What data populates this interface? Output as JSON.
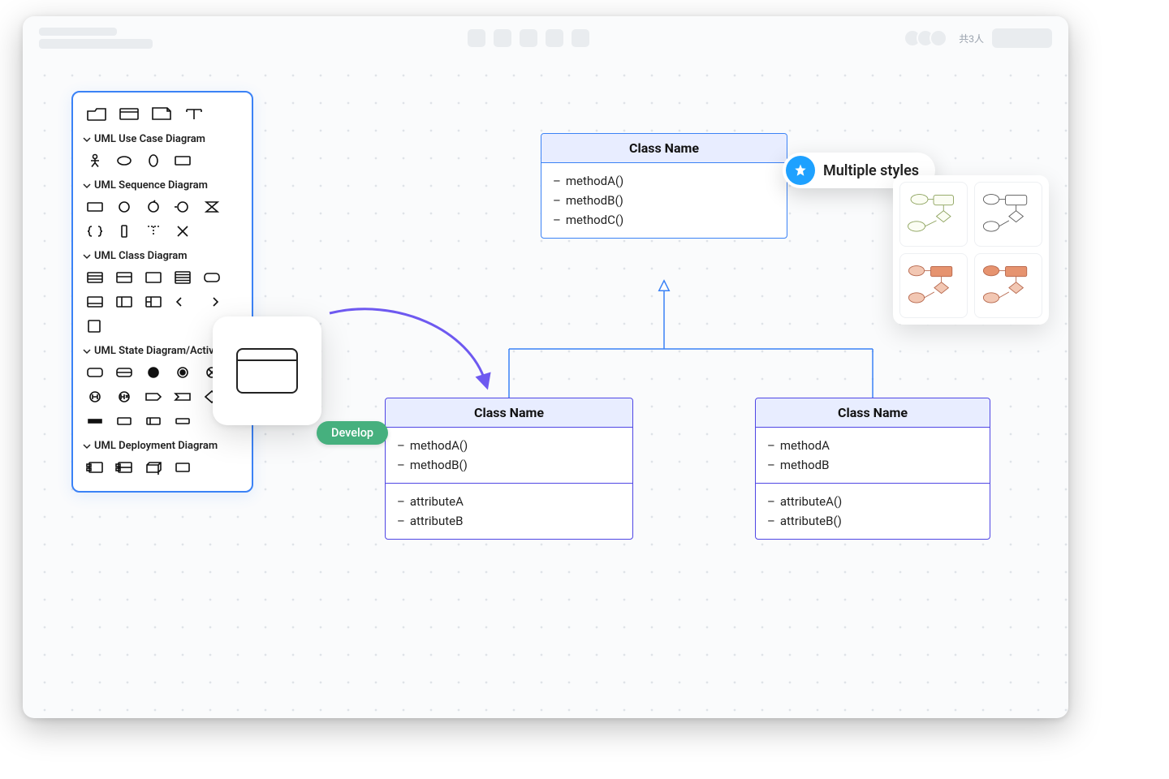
{
  "topbar": {
    "people_count_label": "共3人"
  },
  "sidebar": {
    "sections": [
      {
        "label": "UML Use Case Diagram"
      },
      {
        "label": "UML Sequence Diagram"
      },
      {
        "label": "UML Class Diagram"
      },
      {
        "label": "UML State Diagram/Activ..."
      },
      {
        "label": "UML Deployment Diagram"
      }
    ]
  },
  "drag_label": "Develop",
  "callout": {
    "label": "Multiple styles"
  },
  "classes": {
    "parent": {
      "title": "Class Name",
      "methods": [
        "methodA()",
        "methodB()",
        "methodC()"
      ]
    },
    "left": {
      "title": "Class Name",
      "methods": [
        "methodA()",
        "methodB()"
      ],
      "attributes": [
        "attributeA",
        "attributeB"
      ]
    },
    "right": {
      "title": "Class Name",
      "methods": [
        "methodA",
        "methodB"
      ],
      "attributes": [
        "attributeA()",
        "attributeB()"
      ]
    }
  }
}
